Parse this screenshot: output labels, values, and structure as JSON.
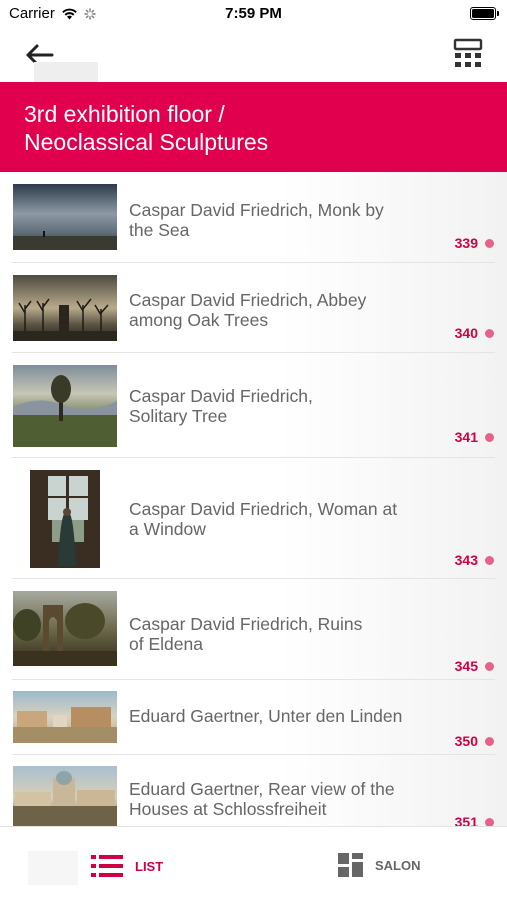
{
  "status_bar": {
    "carrier": "Carrier",
    "time": "7:59 PM"
  },
  "header": {
    "title_line1": "3rd exhibition floor /",
    "title_line2": "Neoclassical Sculptures"
  },
  "items": [
    {
      "title_line1": "Caspar David Friedrich, Monk by",
      "title_line2": "the Sea",
      "number": "339",
      "thumb": "monk-by-the-sea"
    },
    {
      "title_line1": "Caspar David Friedrich, Abbey",
      "title_line2": "among Oak Trees",
      "number": "340",
      "thumb": "abbey-among-oak-trees"
    },
    {
      "title_line1": "Caspar David Friedrich,",
      "title_line2": "Solitary Tree",
      "number": "341",
      "thumb": "solitary-tree"
    },
    {
      "title_line1": "Caspar David Friedrich, Woman at",
      "title_line2": "a Window",
      "number": "343",
      "thumb": "woman-at-a-window"
    },
    {
      "title_line1": "Caspar David Friedrich, Ruins",
      "title_line2": "of Eldena",
      "number": "345",
      "thumb": "ruins-of-eldena"
    },
    {
      "title_line1": "Eduard Gaertner, Unter den Linden",
      "title_line2": "",
      "number": "350",
      "thumb": "unter-den-linden"
    },
    {
      "title_line1": "Eduard Gaertner, Rear view of the",
      "title_line2": "Houses at Schlossfreiheit",
      "number": "351",
      "thumb": "schlossfreiheit"
    }
  ],
  "tabs": {
    "list_label": "LIST",
    "salon_label": "SALON"
  },
  "colors": {
    "accent": "#e0004d",
    "number": "#d10044"
  }
}
